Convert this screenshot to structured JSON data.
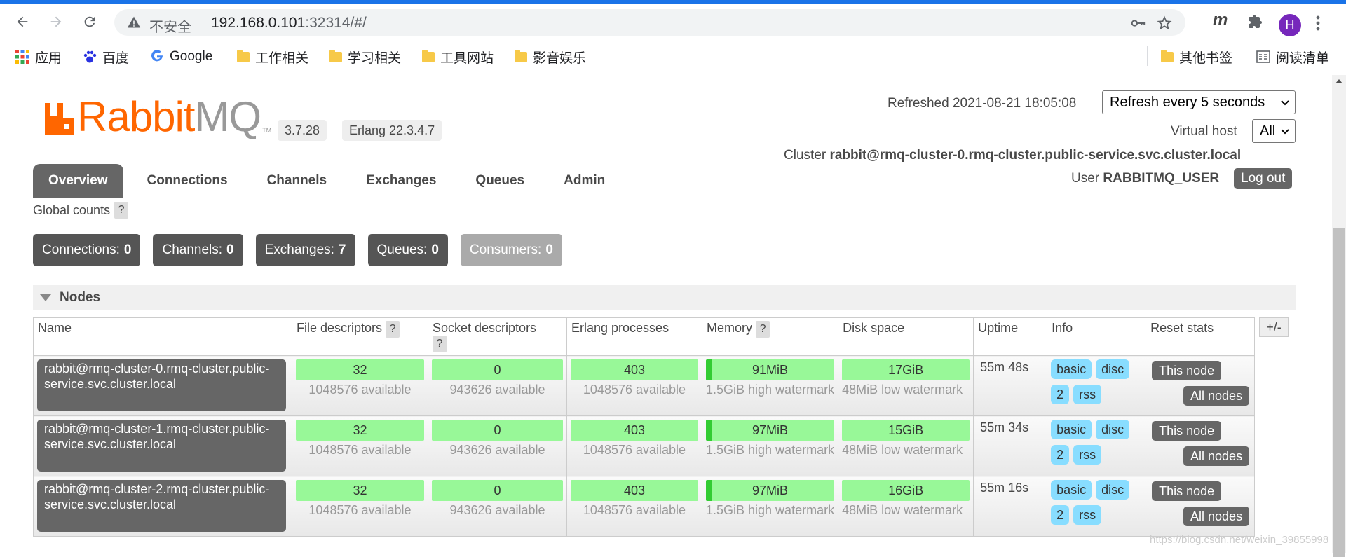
{
  "browser": {
    "insecure_label": "不安全",
    "url_host": "192.168.0.101",
    "url_rest": ":32314/#/",
    "avatar_letter": "H",
    "ext_m": "m",
    "bookmarks": {
      "apps": "应用",
      "baidu": "百度",
      "google": "Google",
      "work": "工作相关",
      "study": "学习相关",
      "tools": "工具网站",
      "media": "影音娱乐",
      "other": "其他书签",
      "reading": "阅读清单"
    }
  },
  "header": {
    "logo_rabbit": "Rabbit",
    "logo_mq": "MQ",
    "logo_tm": "TM",
    "version": "3.7.28",
    "erlang": "Erlang 22.3.4.7",
    "refreshed": "Refreshed 2021-08-21 18:05:08",
    "refresh_select": "Refresh every 5 seconds",
    "vhost_label": "Virtual host",
    "vhost_select": "All",
    "cluster_label": "Cluster ",
    "cluster_name": "rabbit@rmq-cluster-0.rmq-cluster.public-service.svc.cluster.local",
    "user_label": "User ",
    "user_name": "RABBITMQ_USER",
    "logout": "Log out"
  },
  "tabs": [
    "Overview",
    "Connections",
    "Channels",
    "Exchanges",
    "Queues",
    "Admin"
  ],
  "global": {
    "label": "Global counts",
    "help": "?"
  },
  "counts": {
    "connections": "Connections: ",
    "connections_v": "0",
    "channels": "Channels: ",
    "channels_v": "0",
    "exchanges": "Exchanges: ",
    "exchanges_v": "7",
    "queues": "Queues: ",
    "queues_v": "0",
    "consumers": "Consumers: ",
    "consumers_v": "0"
  },
  "nodes_section": "Nodes",
  "columns": {
    "name": "Name",
    "fd": "File descriptors",
    "socket": "Socket descriptors",
    "erlang": "Erlang processes",
    "memory": "Memory",
    "disk": "Disk space",
    "uptime": "Uptime",
    "info": "Info",
    "reset": "Reset stats",
    "plusminus": "+/-",
    "help": "?"
  },
  "nodes": [
    {
      "name": "rabbit@rmq-cluster-0.rmq-cluster.public-service.svc.cluster.local",
      "fd": "32",
      "fd_avail": "1048576 available",
      "socket": "0",
      "socket_avail": "943626 available",
      "erlang": "403",
      "erlang_avail": "1048576 available",
      "memory": "91MiB",
      "memory_sub": "1.5GiB high watermark",
      "disk": "17GiB",
      "disk_sub": "48MiB low watermark",
      "uptime": "55m 48s",
      "tags": [
        "basic",
        "disc",
        "2",
        "rss"
      ],
      "this_node": "This node",
      "all_nodes": "All nodes"
    },
    {
      "name": "rabbit@rmq-cluster-1.rmq-cluster.public-service.svc.cluster.local",
      "fd": "32",
      "fd_avail": "1048576 available",
      "socket": "0",
      "socket_avail": "943626 available",
      "erlang": "403",
      "erlang_avail": "1048576 available",
      "memory": "97MiB",
      "memory_sub": "1.5GiB high watermark",
      "disk": "15GiB",
      "disk_sub": "48MiB low watermark",
      "uptime": "55m 34s",
      "tags": [
        "basic",
        "disc",
        "2",
        "rss"
      ],
      "this_node": "This node",
      "all_nodes": "All nodes"
    },
    {
      "name": "rabbit@rmq-cluster-2.rmq-cluster.public-service.svc.cluster.local",
      "fd": "32",
      "fd_avail": "1048576 available",
      "socket": "0",
      "socket_avail": "943626 available",
      "erlang": "403",
      "erlang_avail": "1048576 available",
      "memory": "97MiB",
      "memory_sub": "1.5GiB high watermark",
      "disk": "16GiB",
      "disk_sub": "48MiB low watermark",
      "uptime": "55m 16s",
      "tags": [
        "basic",
        "disc",
        "2",
        "rss"
      ],
      "this_node": "This node",
      "all_nodes": "All nodes"
    }
  ],
  "watermark": "https://blog.csdn.net/weixin_39855998",
  "colors": {
    "brand": "#ff6600",
    "bar_green": "#98f898",
    "tag_blue": "#88ddff",
    "dark_button": "#666666"
  }
}
